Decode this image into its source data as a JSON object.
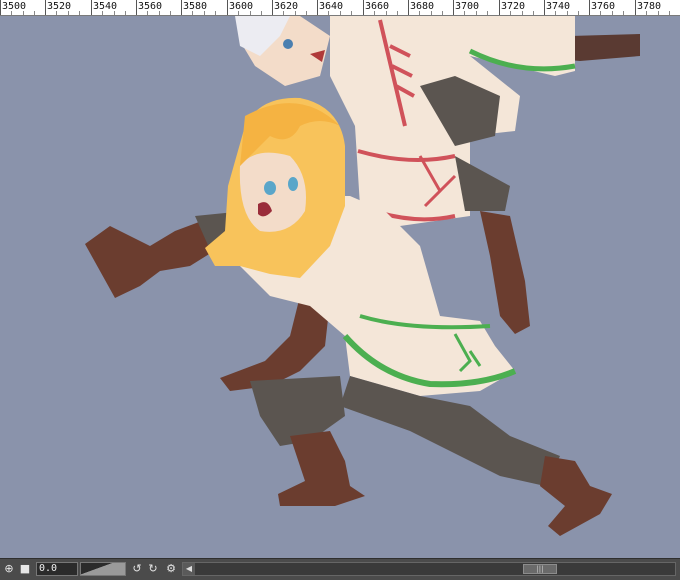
{
  "ruler": {
    "labels": [
      "3500",
      "3520",
      "3540",
      "3560",
      "3580",
      "3600",
      "3620",
      "3640",
      "3660",
      "3680",
      "3700",
      "3720",
      "3740",
      "3760",
      "3780"
    ]
  },
  "canvas": {
    "background": "#8a93ab"
  },
  "statusbar": {
    "value_field": "0.0",
    "icons": [
      "add-icon",
      "square-icon",
      "undo-icon",
      "redo-icon",
      "gear-icon",
      "scroll-left-icon"
    ]
  }
}
